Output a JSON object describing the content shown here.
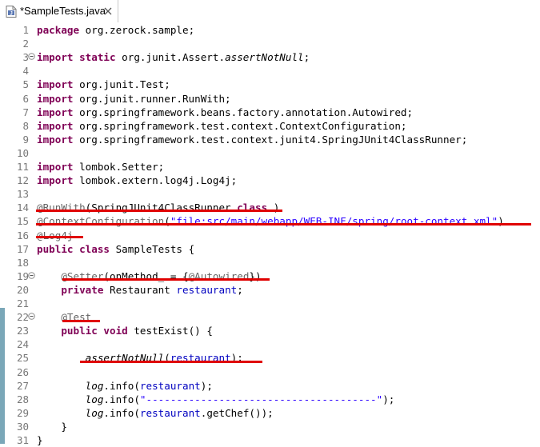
{
  "tab": {
    "title": "*SampleTests.java",
    "close_icon": "close-icon",
    "file_icon": "java-file-icon"
  },
  "colors": {
    "keyword": "#7f0055",
    "annotation": "#646464",
    "field": "#0000c0",
    "string": "#2a00ff",
    "marker": "#e00000"
  },
  "code": {
    "lines": [
      {
        "n": "1",
        "segs": [
          [
            "kw",
            "package"
          ],
          [
            "",
            "org.zerock.sample;"
          ]
        ]
      },
      {
        "n": "2",
        "segs": []
      },
      {
        "n": "3",
        "fold": true,
        "segs": [
          [
            "kw",
            "import"
          ],
          [
            "",
            ""
          ],
          [
            "kw",
            "static"
          ],
          [
            "",
            "org.junit.Assert."
          ],
          [
            "st",
            "assertNotNull"
          ],
          [
            "",
            ";"
          ]
        ]
      },
      {
        "n": "4",
        "segs": []
      },
      {
        "n": "5",
        "segs": [
          [
            "kw",
            "import"
          ],
          [
            "",
            "org.junit.Test;"
          ]
        ]
      },
      {
        "n": "6",
        "segs": [
          [
            "kw",
            "import"
          ],
          [
            "",
            "org.junit.runner.RunWith;"
          ]
        ]
      },
      {
        "n": "7",
        "segs": [
          [
            "kw",
            "import"
          ],
          [
            "",
            "org.springframework.beans.factory.annotation.Autowired;"
          ]
        ]
      },
      {
        "n": "8",
        "segs": [
          [
            "kw",
            "import"
          ],
          [
            "",
            "org.springframework.test.context.ContextConfiguration;"
          ]
        ]
      },
      {
        "n": "9",
        "segs": [
          [
            "kw",
            "import"
          ],
          [
            "",
            "org.springframework.test.context.junit4.SpringJUnit4ClassRunner;"
          ]
        ]
      },
      {
        "n": "10",
        "segs": []
      },
      {
        "n": "11",
        "segs": [
          [
            "kw",
            "import"
          ],
          [
            "",
            "lombok.Setter;"
          ]
        ]
      },
      {
        "n": "12",
        "segs": [
          [
            "kw",
            "import"
          ],
          [
            "",
            "lombok.extern.log4j.Log4j;"
          ]
        ]
      },
      {
        "n": "13",
        "segs": []
      },
      {
        "n": "14",
        "segs": [
          [
            "an",
            "@RunWith"
          ],
          [
            "",
            "(SpringJUnit4ClassRunner."
          ],
          [
            "kw",
            "class"
          ],
          [
            "",
            ")"
          ]
        ]
      },
      {
        "n": "15",
        "segs": [
          [
            "an",
            "@ContextConfiguration"
          ],
          [
            "",
            "("
          ],
          [
            "str",
            "\"file:src/main/webapp/WEB-INF/spring/root-context.xml\""
          ],
          [
            "",
            ")"
          ]
        ]
      },
      {
        "n": "16",
        "segs": [
          [
            "an",
            "@Log4j"
          ]
        ]
      },
      {
        "n": "17",
        "segs": [
          [
            "kw",
            "public"
          ],
          [
            "",
            ""
          ],
          [
            "kw",
            "class"
          ],
          [
            "",
            "SampleTests {"
          ]
        ]
      },
      {
        "n": "18",
        "segs": []
      },
      {
        "n": "19",
        "fold": true,
        "segs": [
          [
            "",
            "    "
          ],
          [
            "an",
            "@Setter"
          ],
          [
            "",
            "(onMethod_ = {"
          ],
          [
            "an",
            "@Autowired"
          ],
          [
            "",
            "})"
          ]
        ]
      },
      {
        "n": "20",
        "segs": [
          [
            "",
            "    "
          ],
          [
            "kw",
            "private"
          ],
          [
            "",
            "Restaurant "
          ],
          [
            "fld",
            "restaurant"
          ],
          [
            "",
            ";"
          ]
        ]
      },
      {
        "n": "21",
        "segs": []
      },
      {
        "n": "22",
        "fold": true,
        "segs": [
          [
            "",
            "    "
          ],
          [
            "an",
            "@Test"
          ]
        ]
      },
      {
        "n": "23",
        "segs": [
          [
            "",
            "    "
          ],
          [
            "kw",
            "public"
          ],
          [
            "",
            ""
          ],
          [
            "kw",
            "void"
          ],
          [
            "",
            "testExist() {"
          ]
        ]
      },
      {
        "n": "24",
        "segs": []
      },
      {
        "n": "25",
        "segs": [
          [
            "",
            "        "
          ],
          [
            "st",
            "assertNotNull"
          ],
          [
            "",
            "("
          ],
          [
            "fld",
            "restaurant"
          ],
          [
            "",
            ");"
          ]
        ]
      },
      {
        "n": "26",
        "segs": []
      },
      {
        "n": "27",
        "segs": [
          [
            "",
            "        "
          ],
          [
            "st",
            "log"
          ],
          [
            "",
            ".info("
          ],
          [
            "fld",
            "restaurant"
          ],
          [
            "",
            ");"
          ]
        ]
      },
      {
        "n": "28",
        "segs": [
          [
            "",
            "        "
          ],
          [
            "st",
            "log"
          ],
          [
            "",
            ".info("
          ],
          [
            "str",
            "\"--------------------------------------\""
          ],
          [
            "",
            ");"
          ]
        ]
      },
      {
        "n": "29",
        "segs": [
          [
            "",
            "        "
          ],
          [
            "st",
            "log"
          ],
          [
            "",
            ".info("
          ],
          [
            "fld",
            "restaurant"
          ],
          [
            "",
            ".getChef());"
          ]
        ]
      },
      {
        "n": "30",
        "segs": [
          [
            "",
            "    }"
          ]
        ]
      },
      {
        "n": "31",
        "segs": [
          [
            "",
            "}"
          ]
        ]
      }
    ]
  }
}
